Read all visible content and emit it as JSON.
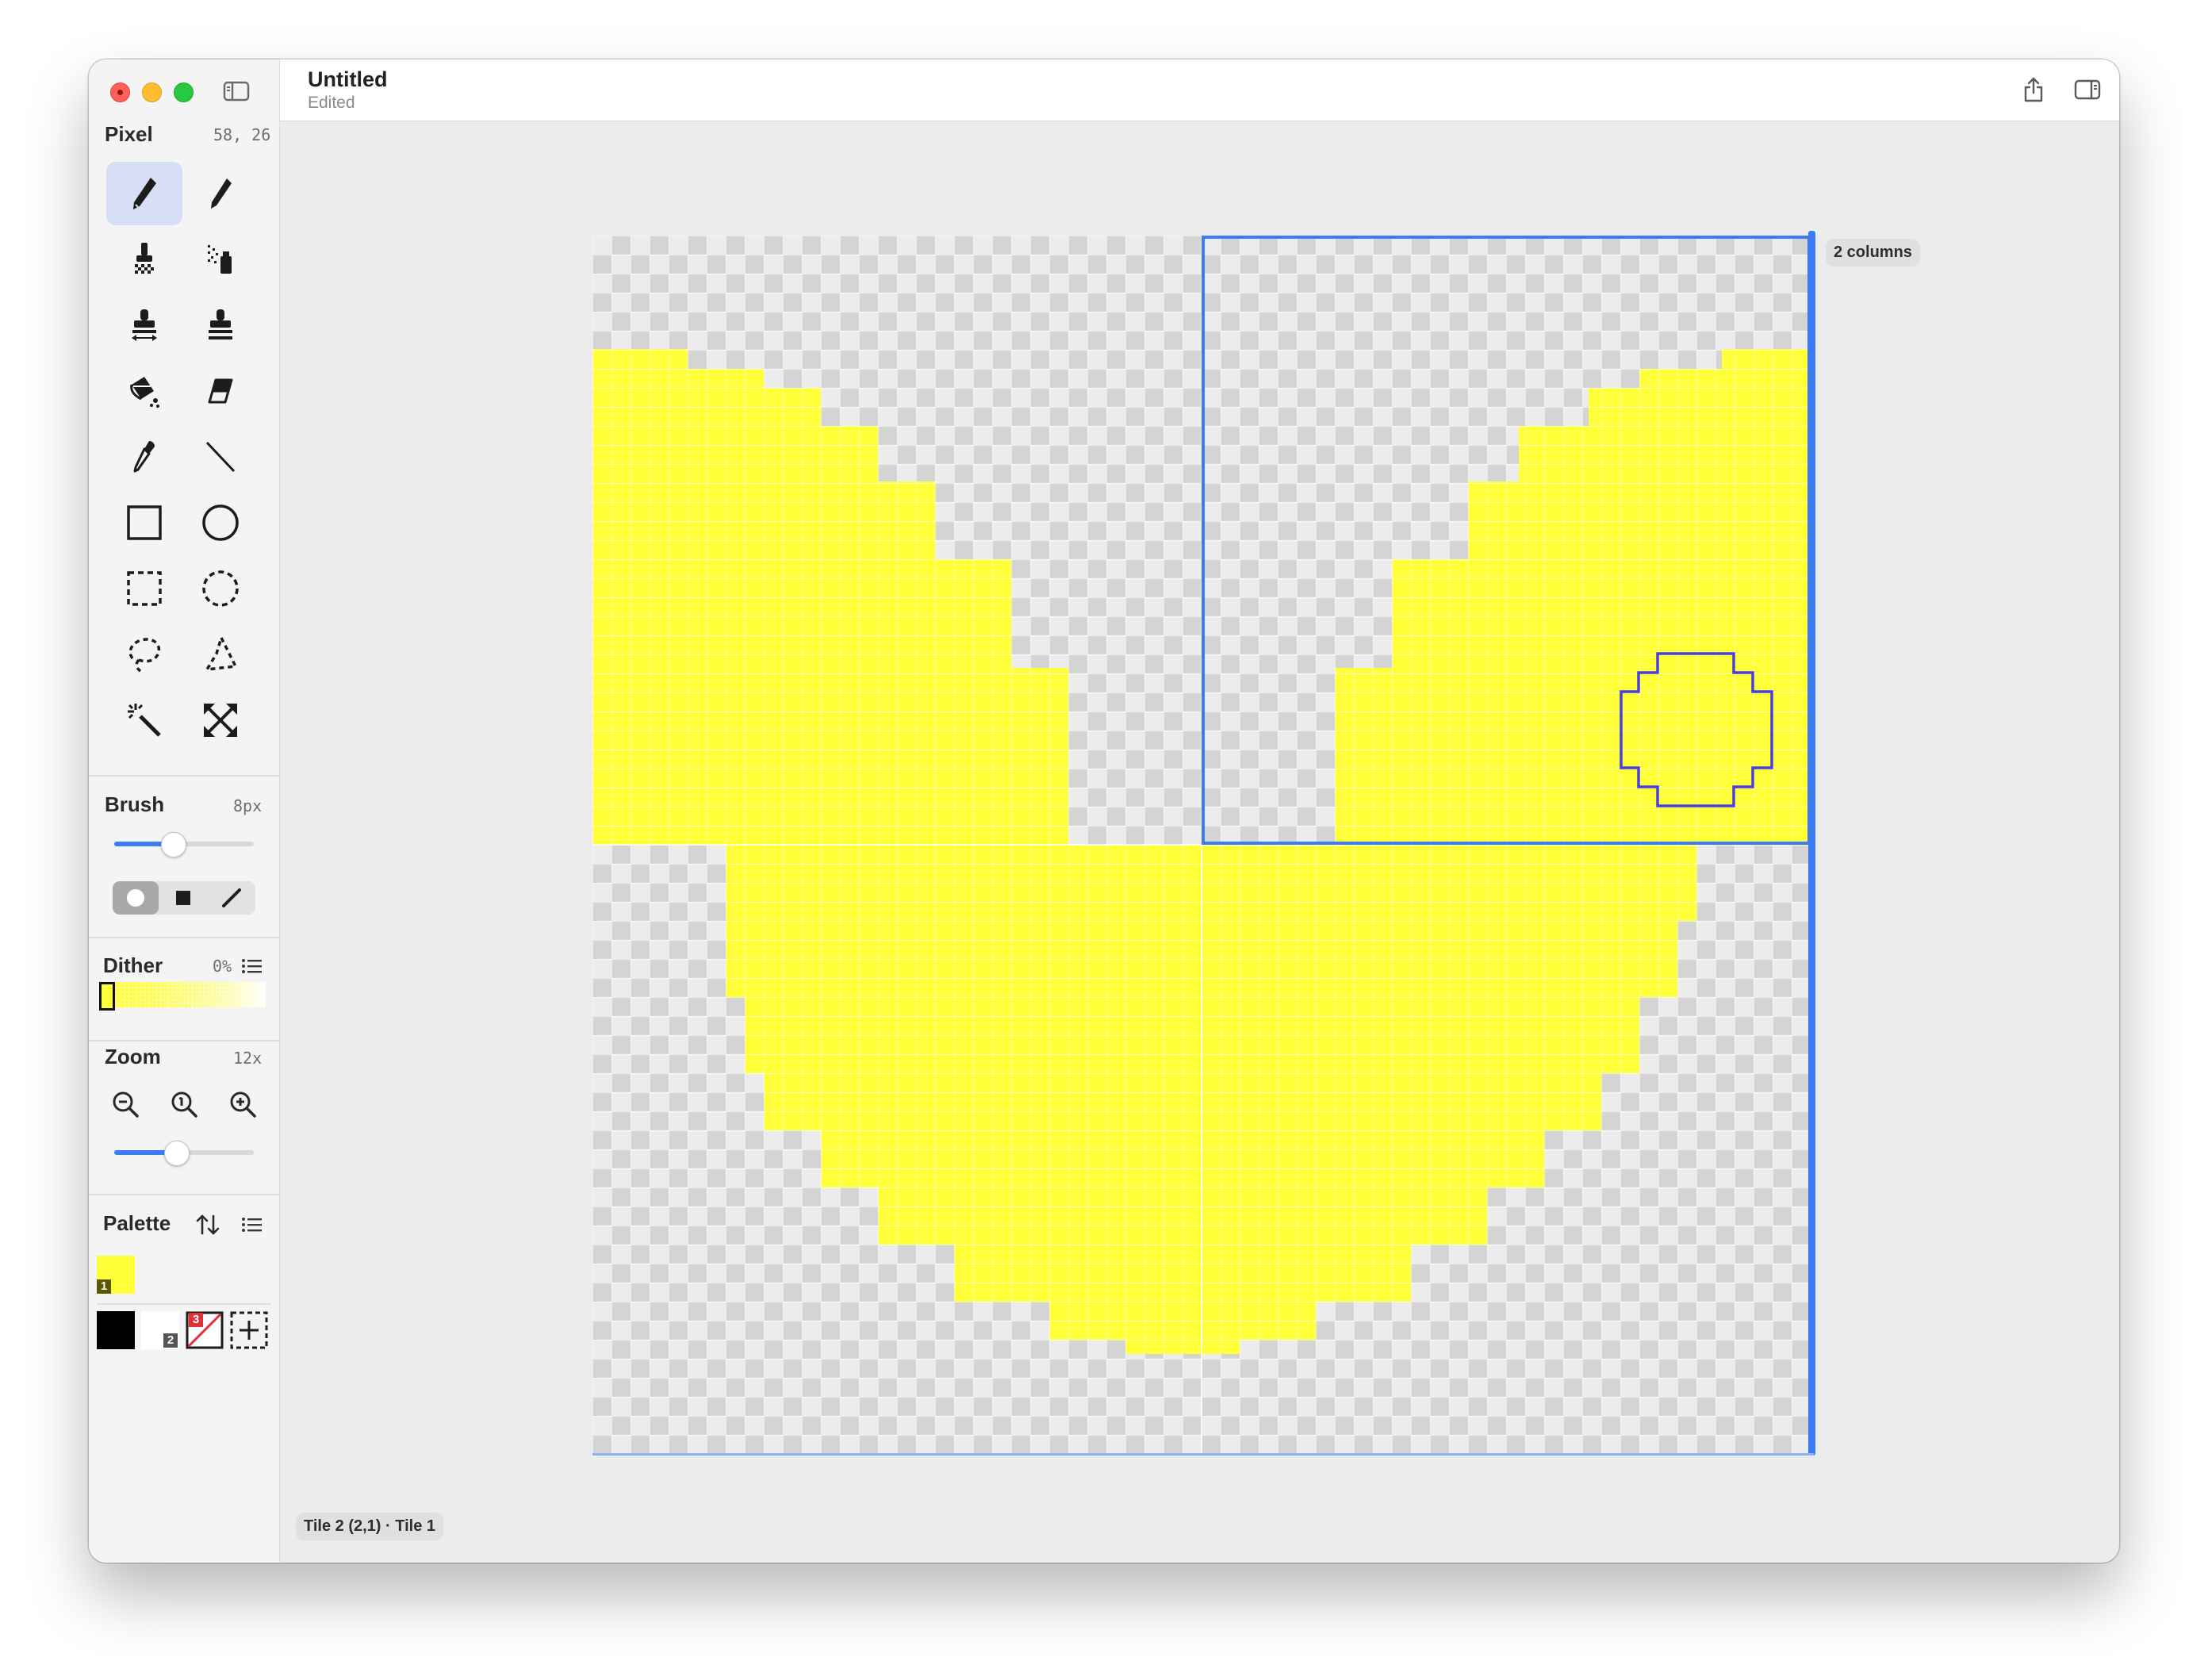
{
  "window": {
    "title": "Untitled",
    "subtitle": "Edited"
  },
  "sidebar": {
    "pixel": {
      "label": "Pixel",
      "coords": "58, 26"
    },
    "tools": [
      {
        "name": "pencil-tool",
        "icon": "pencil-icon",
        "selected": true
      },
      {
        "name": "pen-tool",
        "icon": "pen-icon",
        "selected": false
      },
      {
        "name": "dither-brush-tool",
        "icon": "dither-brush-icon",
        "selected": false
      },
      {
        "name": "spray-tool",
        "icon": "spray-icon",
        "selected": false
      },
      {
        "name": "stamp-mirror-tool",
        "icon": "stamp-mirror-icon",
        "selected": false
      },
      {
        "name": "stamp-tool",
        "icon": "stamp-icon",
        "selected": false
      },
      {
        "name": "fill-bucket-tool",
        "icon": "paint-bucket-icon",
        "selected": false
      },
      {
        "name": "eraser-tool",
        "icon": "eraser-icon",
        "selected": false
      },
      {
        "name": "eyedropper-tool",
        "icon": "eyedropper-icon",
        "selected": false
      },
      {
        "name": "line-tool",
        "icon": "line-icon",
        "selected": false
      },
      {
        "name": "rectangle-tool",
        "icon": "rectangle-icon",
        "selected": false
      },
      {
        "name": "ellipse-tool",
        "icon": "ellipse-icon",
        "selected": false
      },
      {
        "name": "rect-select-tool",
        "icon": "rect-select-icon",
        "selected": false
      },
      {
        "name": "ellipse-select-tool",
        "icon": "ellipse-select-icon",
        "selected": false
      },
      {
        "name": "lasso-tool",
        "icon": "lasso-icon",
        "selected": false
      },
      {
        "name": "polygon-lasso-tool",
        "icon": "polygon-lasso-icon",
        "selected": false
      },
      {
        "name": "magic-wand-tool",
        "icon": "magic-wand-icon",
        "selected": false
      },
      {
        "name": "transform-tool",
        "icon": "transform-arrows-icon",
        "selected": false
      }
    ],
    "brush": {
      "label": "Brush",
      "size": "8px",
      "level": 0.4
    },
    "brush_shapes": [
      "circle",
      "square",
      "line"
    ],
    "dither": {
      "label": "Dither",
      "value": "0%"
    },
    "zoom": {
      "label": "Zoom",
      "value": "12x",
      "level": 0.42
    },
    "palette": {
      "label": "Palette",
      "colors": [
        {
          "index": "1",
          "hex": "#ffff3a"
        }
      ],
      "special": [
        {
          "name": "black",
          "hex": "#000000"
        },
        {
          "name": "white",
          "hex": "#ffffff",
          "index": "2"
        },
        {
          "name": "transparent",
          "index": "3"
        }
      ]
    }
  },
  "canvas": {
    "tile_badge": "2 columns",
    "status": "Tile 2 (2,1) · Tile 1",
    "fill_color": "#ffff3a",
    "selection_color": "#3d7bf5",
    "cursor_color": "#4a3fd6"
  }
}
